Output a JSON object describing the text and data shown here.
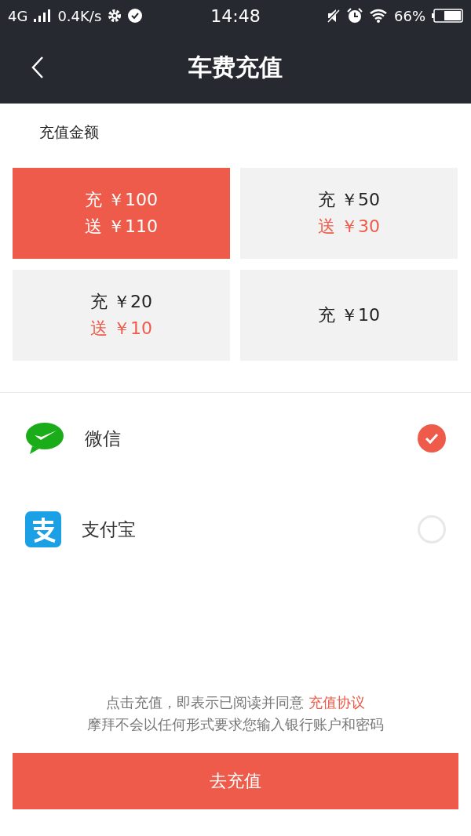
{
  "status_bar": {
    "network": "4G",
    "speed": "0.4K/s",
    "time": "14:48",
    "battery": "66%"
  },
  "header": {
    "title": "车费充值"
  },
  "amount_section": {
    "title": "充值金额"
  },
  "amounts": [
    {
      "charge": "充 ￥100",
      "bonus": "送 ￥110",
      "selected": true
    },
    {
      "charge": "充 ￥50",
      "bonus": "送 ￥30",
      "selected": false
    },
    {
      "charge": "充 ￥20",
      "bonus": "送 ￥10",
      "selected": false
    },
    {
      "charge": "充 ￥10",
      "selected": false
    }
  ],
  "payment_methods": [
    {
      "kind": "wechat",
      "label": "微信",
      "selected": true
    },
    {
      "kind": "alipay",
      "label": "支付宝",
      "selected": false
    }
  ],
  "notice": {
    "text": "点击充值，即表示已阅读并同意",
    "link": "充值协议",
    "line2": "摩拜不会以任何形式要求您输入银行账户和密码"
  },
  "submit_button": "去充值"
}
